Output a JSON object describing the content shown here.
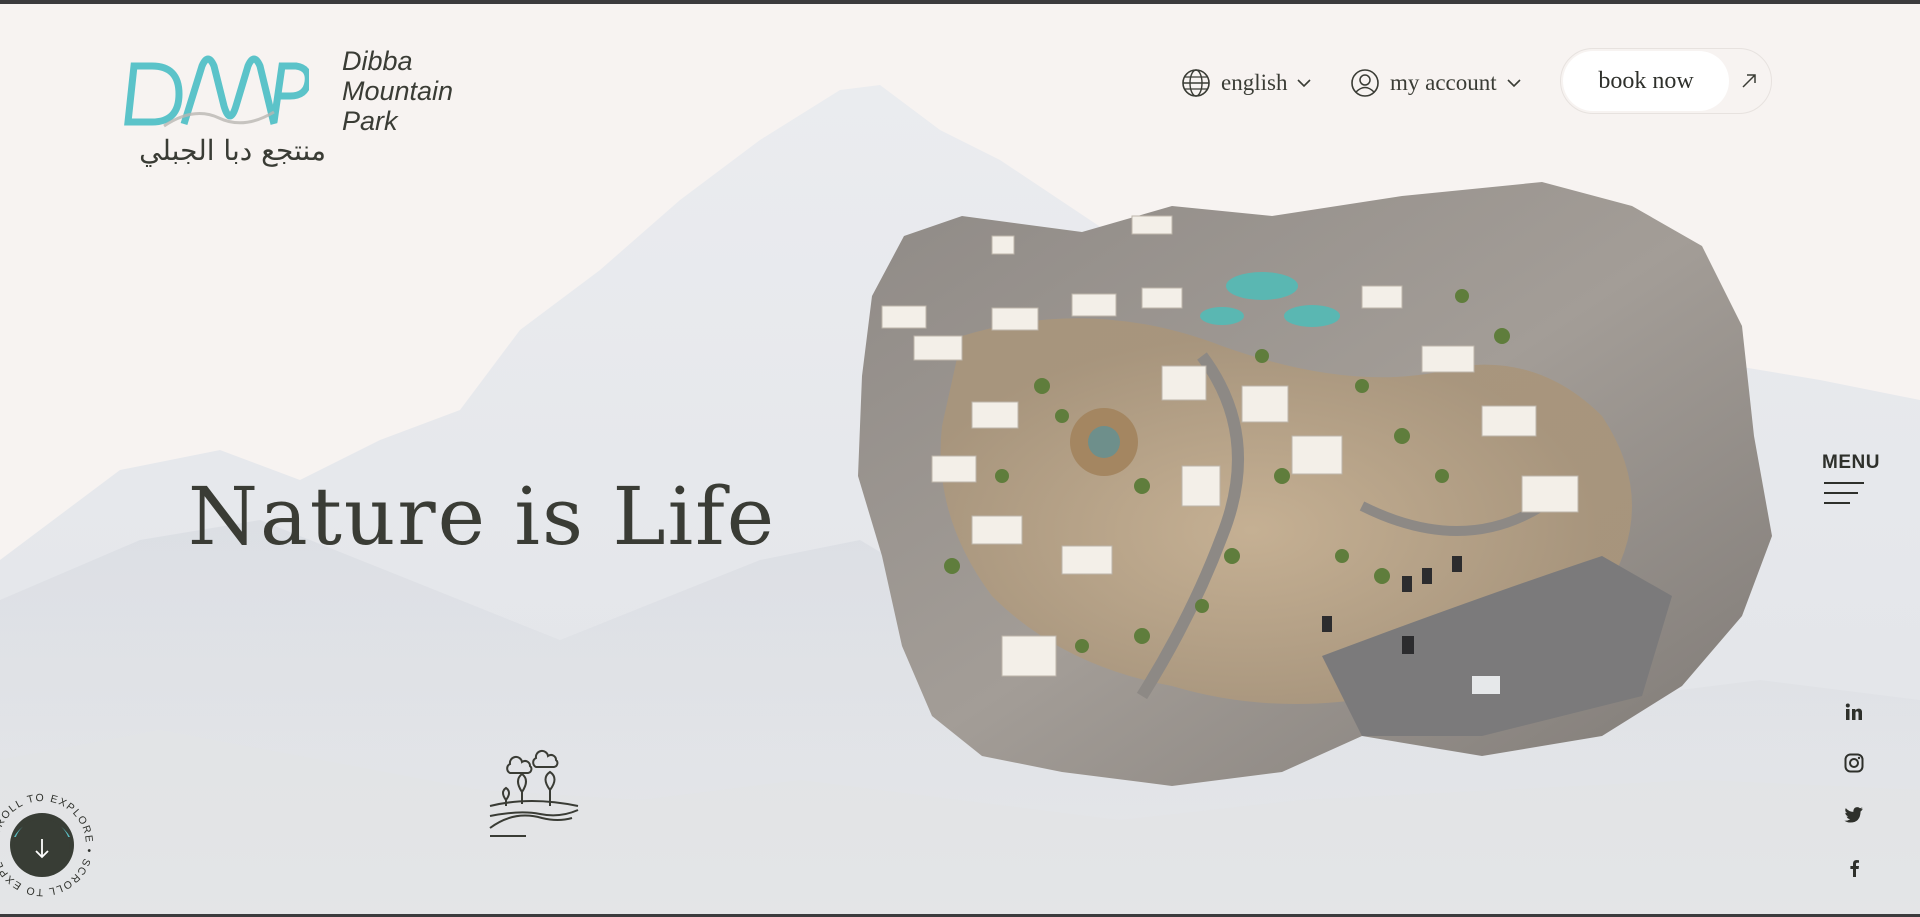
{
  "brand": {
    "name_lines": [
      "Dibba",
      "Mountain",
      "Park"
    ],
    "arabic_name": "منتجع دبا الجبلي",
    "logo_text": "DMP",
    "accent_color": "#5bc3c9"
  },
  "header": {
    "language_label": "english",
    "account_label": "my account",
    "book_label": "book now"
  },
  "hero": {
    "title": "Nature is Life"
  },
  "menu": {
    "label": "MENU"
  },
  "social": [
    "linkedin-icon",
    "instagram-icon",
    "twitter-icon",
    "facebook-icon"
  ],
  "scroll": {
    "label": "SCROLL TO EXPLORE • SCROLL TO EXPLORE • "
  },
  "colors": {
    "background": "#f7f3f1",
    "text": "#3a3c35",
    "accent": "#5bc3c9",
    "scroll_button": "#383d35"
  }
}
